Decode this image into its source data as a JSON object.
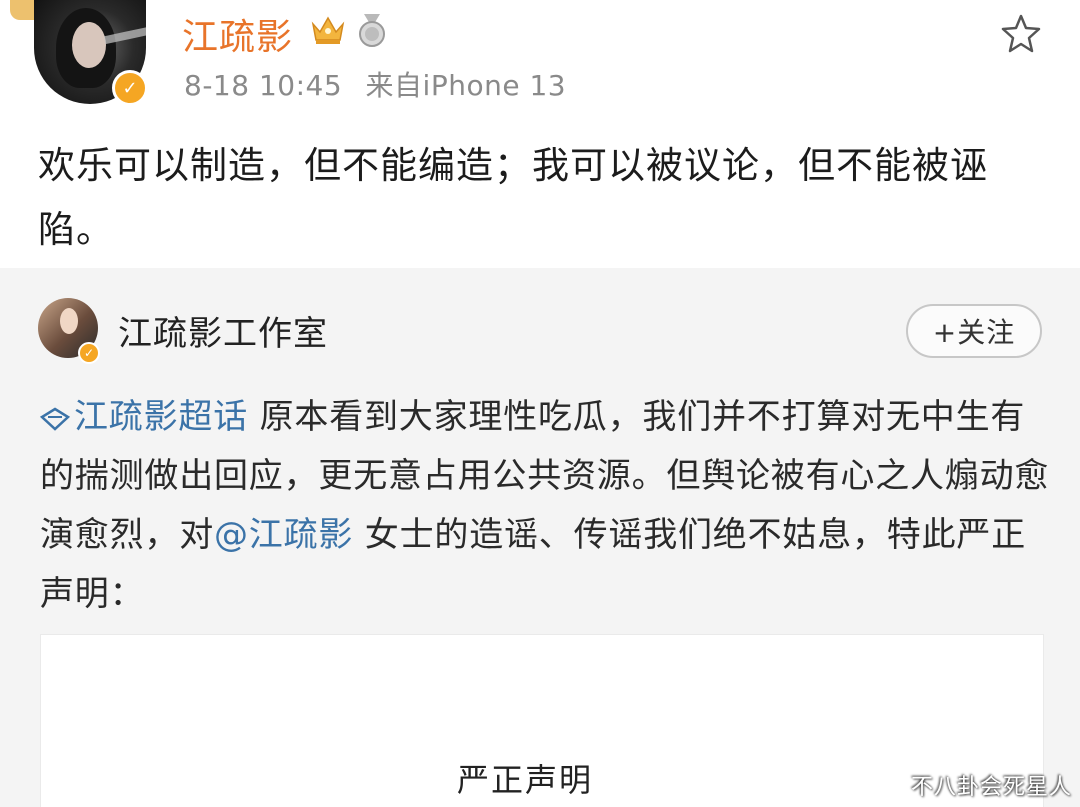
{
  "post": {
    "username": "江疏影",
    "time": "8-18 10:45",
    "source": "来自iPhone 13",
    "text": "欢乐可以制造，但不能编造；我可以被议论，但不能被诬陷。"
  },
  "repost": {
    "author": "江疏影工作室",
    "follow_label": "+关注",
    "topic": "江疏影超话",
    "text_part1": " 原本看到大家理性吃瓜，我们并不打算对无中生有的揣测做出回应，更无意占用公共资源。但舆论被有心之人煽动愈演愈烈，对",
    "mention": "@江疏影",
    "text_part2": " 女士的造谣、传谣我们绝不姑息，特此严正声明：",
    "image_title": "严正声明"
  },
  "watermark": "不八卦会死星人",
  "colors": {
    "username": "#e8742a",
    "link": "#3b73a8",
    "repost_bg": "#f4f4f4",
    "verify_badge": "#f5a623"
  },
  "icons": [
    "crown-icon",
    "medal-icon",
    "star-icon",
    "verified-icon",
    "topic-diamond-icon"
  ]
}
